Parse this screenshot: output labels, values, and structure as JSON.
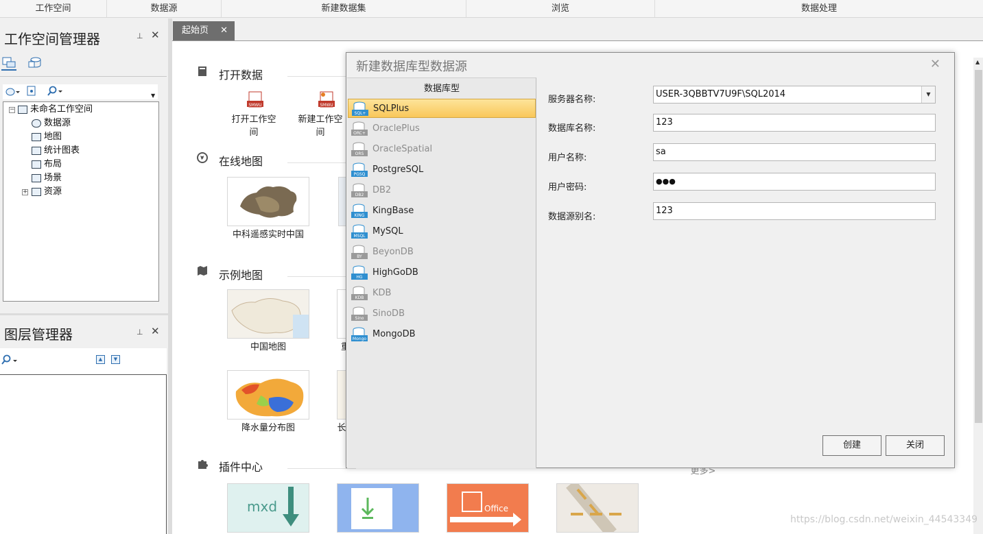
{
  "ribbon": {
    "tabs": [
      "工作空间",
      "数据源",
      "新建数据集",
      "浏览",
      "数据处理"
    ]
  },
  "workspace_manager": {
    "title": "工作空间管理器",
    "pin": "📌",
    "close": "✕",
    "tree": {
      "root": "未命名工作空间",
      "children": [
        "数据源",
        "地图",
        "统计图表",
        "布局",
        "场景",
        "资源"
      ]
    }
  },
  "layer_manager": {
    "title": "图层管理器",
    "pin": "📌",
    "close": "✕"
  },
  "doc_tab": {
    "label": "起始页",
    "close": "✕"
  },
  "start_page": {
    "sections": {
      "open_data": "打开数据",
      "online_map": "在线地图",
      "sample_map": "示例地图",
      "plugin_center": "插件中心"
    },
    "open_items": [
      "打开工作空\n间",
      "新建工作空\n间"
    ],
    "online_maps": [
      "中科遥感实时中国"
    ],
    "sample_maps": [
      "中国地图",
      "降水量分布图"
    ],
    "partial_caps": [
      "重",
      "长"
    ],
    "more": "更多>",
    "plugin_thumbs": [
      "mxd",
      "download",
      "Office",
      "roads"
    ],
    "office_label": "Office",
    "mxd_label": "mxd"
  },
  "dialog": {
    "title": "新建数据库型数据源",
    "close": "✕",
    "type_header": "数据库型",
    "db_types": [
      {
        "name": "SQLPlus",
        "icon": "SQL+",
        "state": "selected"
      },
      {
        "name": "OraclePlus",
        "icon": "ORC+",
        "state": "disabled"
      },
      {
        "name": "OracleSpatial",
        "icon": "ORS",
        "state": "disabled"
      },
      {
        "name": "PostgreSQL",
        "icon": "PGSQ",
        "state": "enabled"
      },
      {
        "name": "DB2",
        "icon": "DB2",
        "state": "disabled"
      },
      {
        "name": "KingBase",
        "icon": "KING",
        "state": "enabled"
      },
      {
        "name": "MySQL",
        "icon": "MSQL",
        "state": "enabled"
      },
      {
        "name": "BeyonDB",
        "icon": "BY",
        "state": "disabled"
      },
      {
        "name": "HighGoDB",
        "icon": "HG",
        "state": "enabled"
      },
      {
        "name": "KDB",
        "icon": "KDB",
        "state": "disabled"
      },
      {
        "name": "SinoDB",
        "icon": "Sino",
        "state": "disabled"
      },
      {
        "name": "MongoDB",
        "icon": "Mongo",
        "state": "enabled"
      }
    ],
    "fields": {
      "server_label": "服务器名称:",
      "server_value": "USER-3QBBTV7U9F\\SQL2014",
      "database_label": "数据库名称:",
      "database_value": "123",
      "user_label": "用户名称:",
      "user_value": "sa",
      "password_label": "用户密码:",
      "password_value": "●●●",
      "alias_label": "数据源别名:",
      "alias_value": "123"
    },
    "buttons": {
      "create": "创建",
      "close": "关闭"
    }
  },
  "watermark": "https://blog.csdn.net/weixin_44543349",
  "colors": {
    "selected_item": "#f9c75a",
    "doc_tab": "#6e6e6e",
    "db_icon_enabled": "#2f8fd0",
    "db_icon_disabled": "#9a9a9a"
  }
}
